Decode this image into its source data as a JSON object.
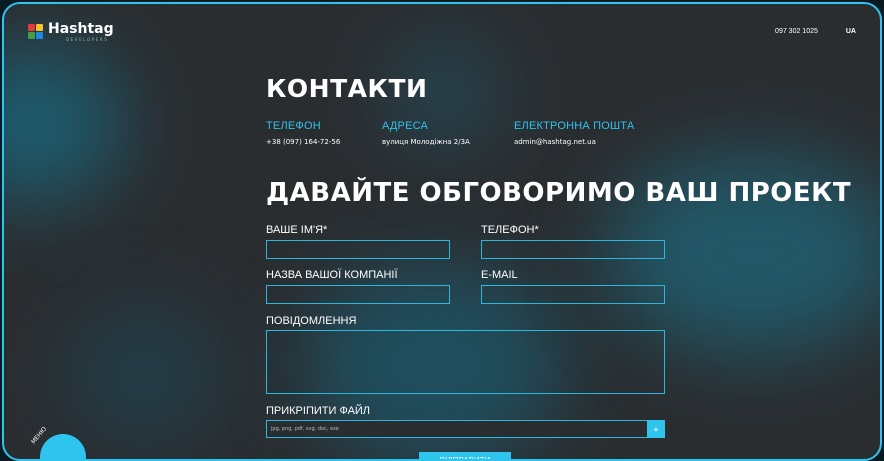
{
  "brand": {
    "name": "Hashtag",
    "sub": "DEVELOPERS",
    "colors": [
      "#e53935",
      "#fbc02d",
      "#43a047",
      "#1e88e5"
    ]
  },
  "header": {
    "phone": "097 302 1025",
    "lang": "UA"
  },
  "contacts": {
    "title": "КОНТАКТИ",
    "phone_label": "ТЕЛЕФОН",
    "phone_value": "+38 (097) 164-72-56",
    "address_label": "АДРЕСА",
    "address_value": "вулиця Молодіжна 2/3А",
    "email_label": "ЕЛЕКТРОННА ПОШТА",
    "email_value": "admin@hashtag.net.ua"
  },
  "form": {
    "title": "ДАВАЙТЕ ОБГОВОРИМО ВАШ ПРОЕКТ",
    "name_label": "ВАШЕ ІМ'Я*",
    "phone_label": "ТЕЛЕФОН*",
    "company_label": "НАЗВА ВАШОЇ КОМПАНІЇ",
    "email_label": "E-MAIL",
    "message_label": "ПОВІДОМЛЕННЯ",
    "file_label": "ПРИКРІПИТИ ФАЙЛ",
    "file_placeholder": "jpg, png, pdf, svg, doc, exe",
    "file_button": "+",
    "submit_label": "ВІДПРАВИТИ"
  },
  "menu": {
    "label": "МЕНЮ"
  },
  "accent": "#2ec4ee"
}
